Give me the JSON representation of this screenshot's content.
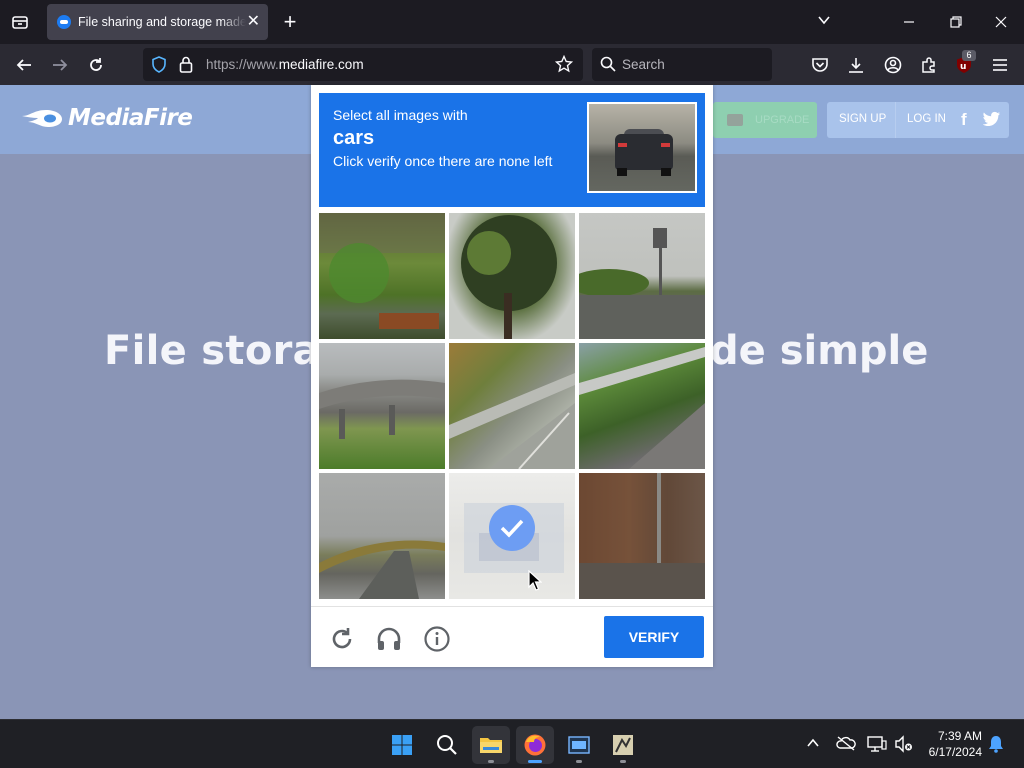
{
  "browser": {
    "tab_title": "File sharing and storage made simple",
    "url_prefix": "https://www.",
    "url_domain": "mediafire.com",
    "search_placeholder": "Search",
    "extension_badge": "6"
  },
  "page": {
    "logo_text": "MediaFire",
    "upgrade_label": "UPGRADE",
    "signup_label": "SIGN UP",
    "login_label": "LOG IN",
    "hero_left": "File storag",
    "hero_right": "de simple"
  },
  "captcha": {
    "instruction_line1": "Select all images with",
    "target_object": "cars",
    "instruction_line2": "Click verify once there are none left",
    "verify_label": "VERIFY",
    "selected_tile_index": 7,
    "accent_color": "#1a73e8"
  },
  "taskbar": {
    "time": "7:39 AM",
    "date": "6/17/2024"
  }
}
